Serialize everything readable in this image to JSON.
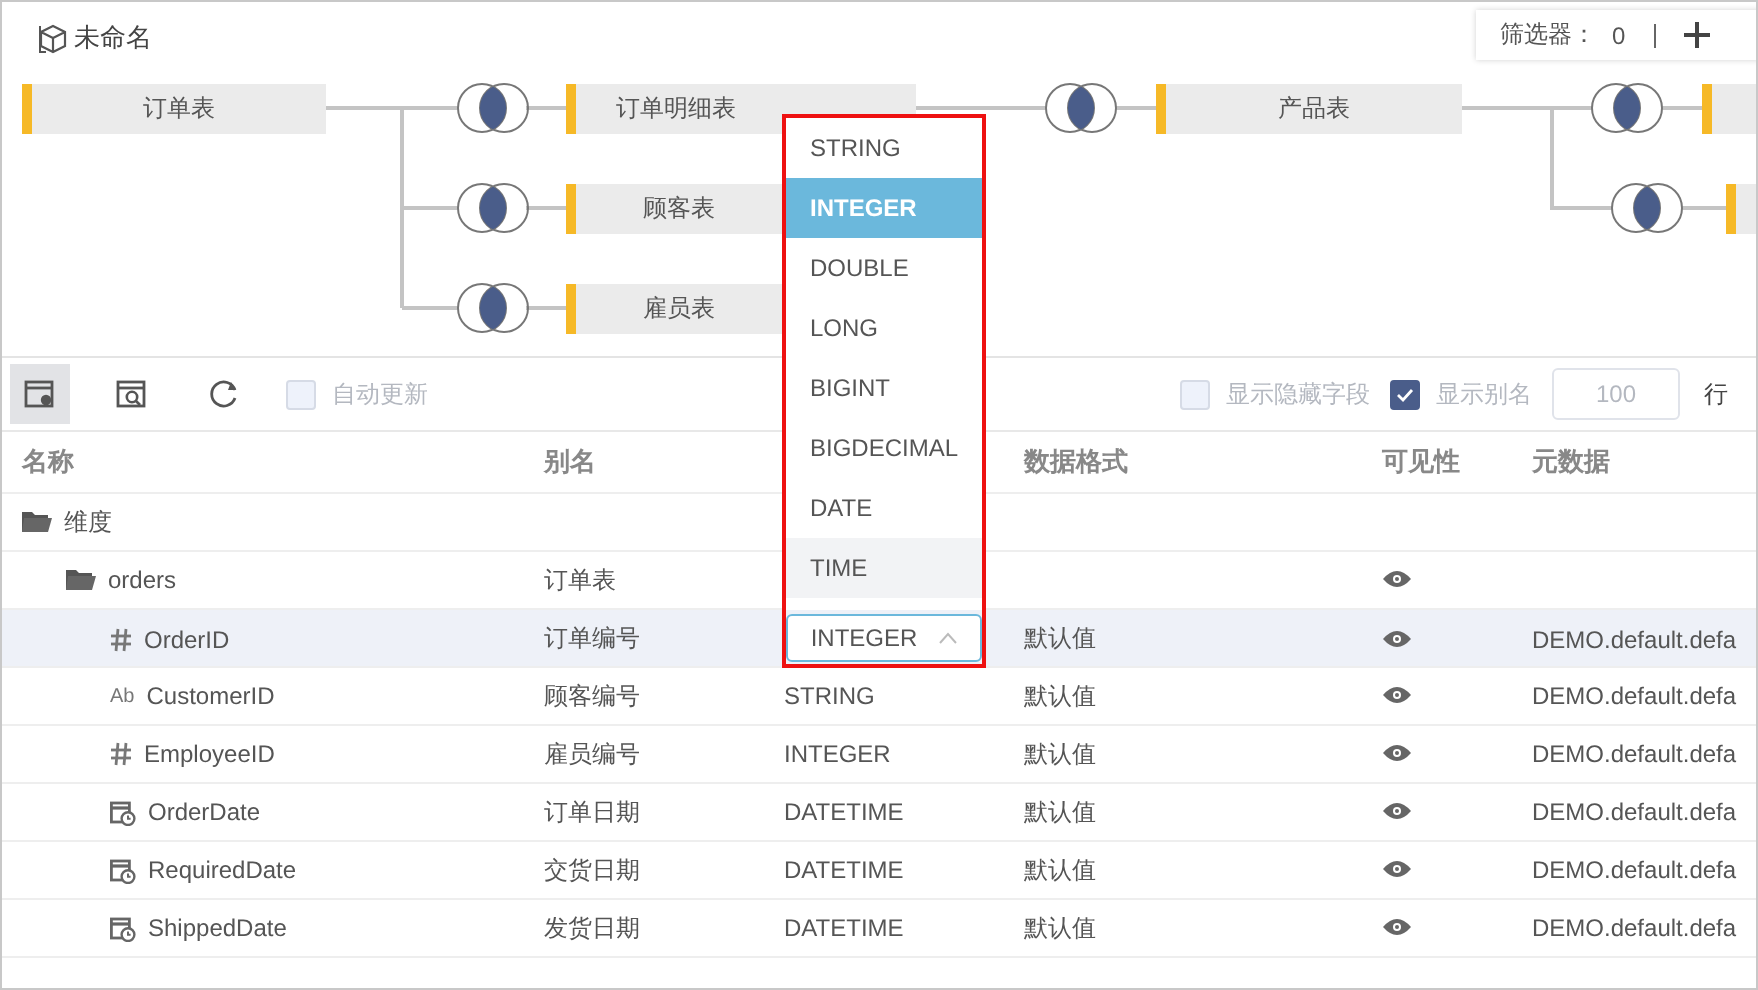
{
  "title": "未命名",
  "filter": {
    "label": "筛选器：",
    "count": "0"
  },
  "diagram": {
    "nodes": [
      "订单表",
      "订单明细表",
      "顾客表",
      "雇员表",
      "产品表"
    ]
  },
  "toolbar": {
    "buttons": [
      {
        "kind": "settings",
        "selected": true
      },
      {
        "kind": "preview",
        "selected": false
      },
      {
        "kind": "refresh",
        "selected": false
      }
    ],
    "auto_update": {
      "label": "自动更新",
      "checked": false
    },
    "show_hidden": {
      "label": "显示隐藏字段",
      "checked": false
    },
    "show_alias": {
      "label": "显示别名",
      "checked": true
    },
    "row_limit": "100",
    "row_unit": "行"
  },
  "table": {
    "columns": [
      "名称",
      "别名",
      "数据格式",
      "可见性",
      "元数据"
    ],
    "rows": [
      {
        "kind": "folder",
        "name": "维度",
        "selected": false,
        "children": [
          {
            "kind": "folder",
            "name": "orders",
            "alias": "订单表",
            "visible": true,
            "selected": false,
            "children": [
              {
                "kind": "number",
                "name": "OrderID",
                "alias": "订单编号",
                "type": "INTEGER",
                "format": "默认值",
                "visible": true,
                "metadata": "DEMO.default.defa",
                "selected": true
              },
              {
                "kind": "string",
                "glyph": "Ab",
                "name": "CustomerID",
                "alias": "顾客编号",
                "type": "STRING",
                "format": "默认值",
                "visible": true,
                "metadata": "DEMO.default.defa",
                "selected": false
              },
              {
                "kind": "number",
                "name": "EmployeeID",
                "alias": "雇员编号",
                "type": "INTEGER",
                "format": "默认值",
                "visible": true,
                "metadata": "DEMO.default.defa",
                "selected": false
              },
              {
                "kind": "date",
                "name": "OrderDate",
                "alias": "订单日期",
                "type": "DATETIME",
                "format": "默认值",
                "visible": true,
                "metadata": "DEMO.default.defa",
                "selected": false
              },
              {
                "kind": "date",
                "name": "RequiredDate",
                "alias": "交货日期",
                "type": "DATETIME",
                "format": "默认值",
                "visible": true,
                "metadata": "DEMO.default.defa",
                "selected": false
              },
              {
                "kind": "date",
                "name": "ShippedDate",
                "alias": "发货日期",
                "type": "DATETIME",
                "format": "默认值",
                "visible": true,
                "metadata": "DEMO.default.defa",
                "selected": false
              }
            ]
          }
        ]
      }
    ]
  },
  "type_menu": {
    "options": [
      {
        "label": "STRING",
        "selected": false,
        "hovered": false
      },
      {
        "label": "INTEGER",
        "selected": true,
        "hovered": false
      },
      {
        "label": "DOUBLE",
        "selected": false,
        "hovered": false
      },
      {
        "label": "LONG",
        "selected": false,
        "hovered": false
      },
      {
        "label": "BIGINT",
        "selected": false,
        "hovered": false
      },
      {
        "label": "BIGDECIMAL",
        "selected": false,
        "hovered": false
      },
      {
        "label": "DATE",
        "selected": false,
        "hovered": false
      },
      {
        "label": "TIME",
        "selected": false,
        "hovered": true
      }
    ]
  }
}
